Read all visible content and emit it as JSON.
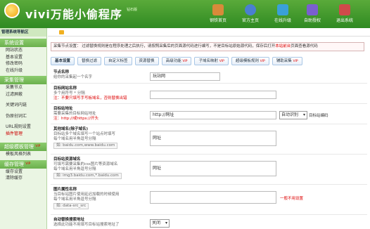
{
  "header": {
    "logo_text": "vivi万能小偷程序",
    "logo_badge": "钻石版",
    "nav": [
      {
        "label": "钢铁首页",
        "icon": "house-icon",
        "color": "#d88a3a"
      },
      {
        "label": "官方主页",
        "icon": "globe-icon",
        "color": "#4a7fd0"
      },
      {
        "label": "在线升级",
        "icon": "upgrade-icon",
        "color": "#3aa0d8"
      },
      {
        "label": "自助授权",
        "icon": "key-icon",
        "color": "#7a5fd0"
      },
      {
        "label": "退出系统",
        "icon": "exit-icon",
        "color": "#d04a4a"
      }
    ]
  },
  "sidebar": {
    "title": "管理系统导航区",
    "sections": [
      {
        "label": "系统设置",
        "vip": "",
        "items": [
          {
            "label": "网站状态"
          },
          {
            "label": "基本设置"
          },
          {
            "label": "修改密码"
          },
          {
            "label": "在线升级"
          }
        ]
      },
      {
        "label": "采集管理",
        "vip": "",
        "items": [
          {
            "label": "采集节点"
          },
          {
            "label": "过滤屏蔽"
          },
          {
            "label": ""
          },
          {
            "label": "关键词内链"
          },
          {
            "label": ""
          },
          {
            "label": "伪原创词汇"
          },
          {
            "label": ""
          },
          {
            "label": "URL规则设置"
          },
          {
            "label": "插件管理",
            "red": true
          }
        ]
      },
      {
        "label": "超级模板管理",
        "vip": "VIP",
        "items": [
          {
            "label": "模板风格列表"
          }
        ]
      },
      {
        "label": "缓存管理",
        "vip": "VIP",
        "items": [
          {
            "label": "缓存设置"
          },
          {
            "label": "清除缓存"
          }
        ]
      }
    ]
  },
  "notice": {
    "pre": "采集节点设置：",
    "text": "过滤替换规则是在程序处理之后执行，请按照采集后的页面源代码进行编写，不是目标站原始源代码，保存后打开",
    "link": "本站前台",
    "post": "页面查看源代码"
  },
  "tabs": [
    {
      "label": "基本设置",
      "vip": "",
      "active": true
    },
    {
      "label": "替换过滤",
      "vip": ""
    },
    {
      "label": "自定义标签",
      "vip": ""
    },
    {
      "label": "资源替换",
      "vip": ""
    },
    {
      "label": "高级功能",
      "vip": "VIP"
    },
    {
      "label": "子域名映射",
      "vip": "VIP"
    },
    {
      "label": "超级模板规则",
      "vip": "VIP"
    },
    {
      "label": "辅助采集",
      "vip": "VIP"
    }
  ],
  "form": {
    "node": {
      "title": "节点名称",
      "desc": "给你的采集起一个名字",
      "value": "玩站网"
    },
    "target_domain": {
      "title": "目标网站名称",
      "desc": "多个用符号 * 分隔",
      "note": "注：不要只填写手写板域名，否则替换出错",
      "value": ""
    },
    "target_url": {
      "title": "目标站地址",
      "desc": "需要采集的目标网站地址",
      "note": "注：http://或https://开头",
      "value": "http://网址",
      "select": "自动识别",
      "side_label": "目标站编码"
    },
    "other_domain": {
      "title": "其他域名(除子域名)",
      "desc": "目标站多个域名填写一个站点时填写",
      "desc2": "每个域名用半角逗号分隔",
      "hint": "如: baidu.com,www.baidu.com",
      "value": "网址"
    },
    "resource_domain": {
      "title": "目标站资源域名",
      "desc": "可填写需要采集的css图片等资源域名",
      "desc2": "每个域名用半角逗号分隔",
      "hint": "如: img3.baidu.com,*.baidu.com",
      "value": "网址"
    },
    "img_attr": {
      "title": "图片属性名称",
      "desc": "当目标站图片使用延迟加载的时候使用",
      "desc2": "每个域名用半角逗号分隔",
      "hint": "如: data-src_src",
      "value": "",
      "side_label": "一般不用设置"
    },
    "auto_replace": {
      "title": "自动替换搜索地址",
      "desc": "选择此功能不用填写目标站搜索地址了",
      "select": "关闭"
    }
  }
}
